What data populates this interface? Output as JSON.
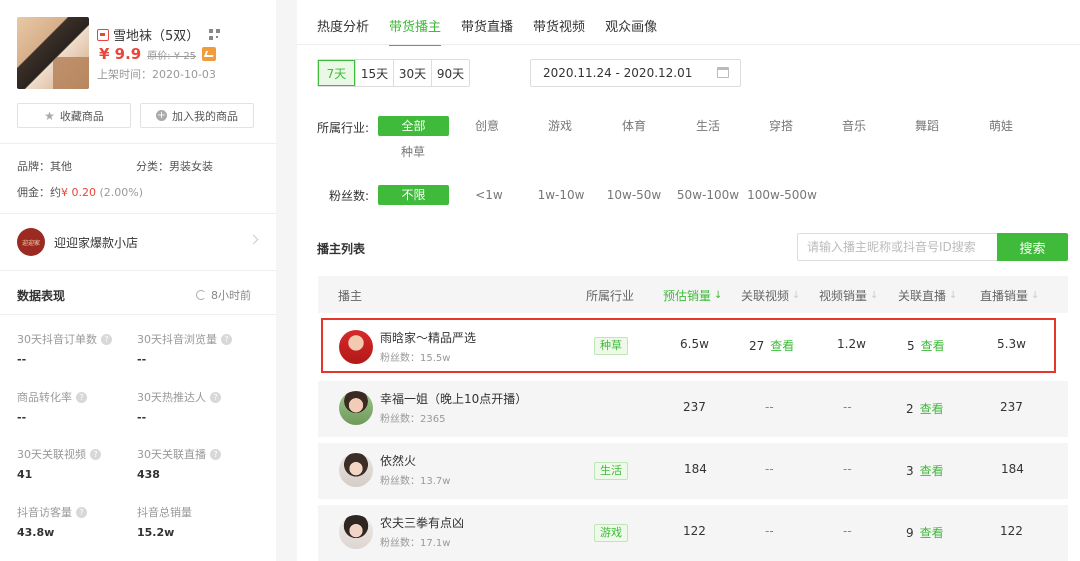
{
  "product": {
    "title": "雪地袜（5双）",
    "price": "¥ 9.9",
    "original_price": "原价: ¥ 25",
    "listed_date": "上架时间：2020-10-03",
    "favorite_label": "收藏商品",
    "add_label": "加入我的商品",
    "brand": "品牌：其他",
    "category": "分类：男装女装",
    "commission_prefix": "佣金：约",
    "commission_value": "¥ 0.20",
    "commission_rate": "(2.00%)",
    "shop_logo_text": "迎迎家",
    "shop_name": "迎迎家爆款小店"
  },
  "stats": {
    "title": "数据表现",
    "updated": "8小时前",
    "metrics": [
      {
        "label": "30天抖音订单数",
        "value": "--"
      },
      {
        "label": "30天抖音浏览量",
        "value": "--"
      },
      {
        "label": "商品转化率",
        "value": "--"
      },
      {
        "label": "30天热推达人",
        "value": "--"
      },
      {
        "label": "30天关联视频",
        "value": "41"
      },
      {
        "label": "30天关联直播",
        "value": "438"
      },
      {
        "label": "抖音访客量",
        "value": "43.8w"
      },
      {
        "label": "抖音总销量",
        "value": "15.2w"
      }
    ]
  },
  "tabs": [
    "热度分析",
    "带货播主",
    "带货直播",
    "带货视频",
    "观众画像"
  ],
  "day_options": [
    "7天",
    "15天",
    "30天",
    "90天"
  ],
  "date_range": "2020.11.24 - 2020.12.01",
  "industry": {
    "label": "所属行业:",
    "options": [
      "全部",
      "创意",
      "游戏",
      "体育",
      "生活",
      "穿搭",
      "音乐",
      "舞蹈",
      "萌娃",
      "种草"
    ]
  },
  "fans_filter": {
    "label": "粉丝数:",
    "options": [
      "不限",
      "<1w",
      "1w-10w",
      "10w-50w",
      "50w-100w",
      "100w-500w"
    ]
  },
  "list": {
    "title": "播主列表",
    "search_placeholder": "请输入播主昵称或抖音号ID搜索",
    "search_button": "搜索",
    "columns": [
      "播主",
      "所属行业",
      "预估销量",
      "关联视频",
      "视频销量",
      "关联直播",
      "直播销量"
    ],
    "view_label": "查看",
    "rows": [
      {
        "name": "雨晗家～精品严选",
        "fans": "粉丝数：15.5w",
        "category": "种草",
        "est_sales": "6.5w",
        "videos": "27",
        "video_sales": "1.2w",
        "lives": "5",
        "live_sales": "5.3w"
      },
      {
        "name": "幸福一姐（晚上10点开播）",
        "fans": "粉丝数：2365",
        "category": "",
        "est_sales": "237",
        "videos": "--",
        "video_sales": "--",
        "lives": "2",
        "live_sales": "237"
      },
      {
        "name": "依然火",
        "fans": "粉丝数：13.7w",
        "category": "生活",
        "est_sales": "184",
        "videos": "--",
        "video_sales": "--",
        "lives": "3",
        "live_sales": "184"
      },
      {
        "name": "农夫三拳有点凶",
        "fans": "粉丝数：17.1w",
        "category": "游戏",
        "est_sales": "122",
        "videos": "--",
        "video_sales": "--",
        "lives": "9",
        "live_sales": "122"
      }
    ]
  },
  "colors": {
    "accent": "#3fba3a",
    "price": "#e9453a",
    "highlight_border": "#e5362c"
  }
}
